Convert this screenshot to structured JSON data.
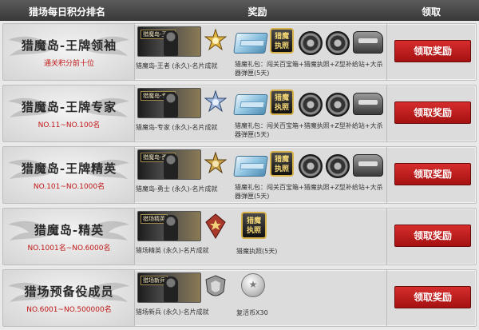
{
  "header": {
    "rank_col": "猎场每日积分排名",
    "reward_col": "奖励",
    "claim_col": "领取"
  },
  "rows": [
    {
      "title": "猎魔岛-王牌领袖",
      "subtitle": "通关积分前十位",
      "achievement_banner": "猎魔岛-王者",
      "achievement_label": "猎魔岛-王者 (永久)-名片成就",
      "pack_license": "猎魔\n执照",
      "pack_label": "猎魔礼包：闯关百宝箱+猎魔执照+Z型补给站+大杀器弹匣(5天)",
      "claim_label": "领取奖励"
    },
    {
      "title": "猎魔岛-王牌专家",
      "subtitle": "NO.11~NO.100名",
      "achievement_banner": "猎魔岛-专家",
      "achievement_label": "猎魔岛-专家 (永久)-名片成就",
      "pack_license": "猎魔\n执照",
      "pack_label": "猎魔礼包：闯关百宝箱+猎魔执照+Z型补给站+大杀器弹匣(5天)",
      "claim_label": "领取奖励"
    },
    {
      "title": "猎魔岛-王牌精英",
      "subtitle": "NO.101~NO.1000名",
      "achievement_banner": "猎魔岛-勇士",
      "achievement_label": "猎魔岛-勇士 (永久)-名片成就",
      "pack_license": "猎魔\n执照",
      "pack_label": "猎魔礼包：闯关百宝箱+猎魔执照+Z型补给站+大杀器弹匣(5天)",
      "claim_label": "领取奖励"
    },
    {
      "title": "猎魔岛-精英",
      "subtitle": "NO.1001名~NO.6000名",
      "achievement_banner": "猎场精英",
      "achievement_label": "猎场精英 (永久)-名片成就",
      "single_license": "猎魔\n执照",
      "single_label": "猎魔执照(5天)",
      "claim_label": "领取奖励"
    },
    {
      "title": "猎场预备役成员",
      "subtitle": "NO.6001~NO.500000名",
      "achievement_banner": "猎场新兵",
      "achievement_label": "猎场新兵 (永久)-名片成就",
      "coin_label": "复活币X30",
      "claim_label": "领取奖励"
    }
  ],
  "colors": {
    "header_bg": "#4a4a4a",
    "row_bg": "#dcdcdc",
    "subtitle_red": "#c01818",
    "button_red": "#c01f1f",
    "license_gold": "#d7b14a"
  },
  "icons": {
    "rank_bg": "wing-emblem-icon",
    "medal": "star-medal-icon",
    "crate": "treasure-chest-icon",
    "license": "hunter-license-icon",
    "mine": "supply-mine-icon",
    "turret": "ammo-turret-icon",
    "coin": "revive-coin-icon"
  }
}
